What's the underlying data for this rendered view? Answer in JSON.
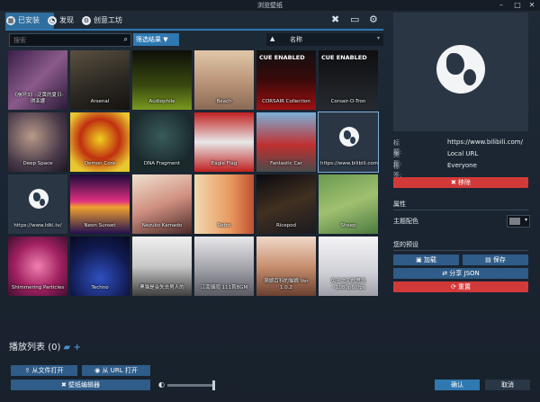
{
  "window": {
    "title": "浏览壁纸"
  },
  "tabs": [
    {
      "label": "已安装",
      "active": true
    },
    {
      "label": "发现",
      "active": false
    },
    {
      "label": "创意工坊",
      "active": false
    }
  ],
  "search": {
    "placeholder": "搜索"
  },
  "filter": {
    "label": "筛选结果"
  },
  "sort": {
    "label": "名称"
  },
  "wallpapers": [
    {
      "title": "《崩坏3》-泛黄的夏日-琪亚娜"
    },
    {
      "title": "Arsenal"
    },
    {
      "title": "Audiophile"
    },
    {
      "title": "Beach"
    },
    {
      "title": "CORSAIR Collection",
      "badge": "CUE ENABLED"
    },
    {
      "title": "Corsair-O-Tron",
      "badge": "CUE ENABLED"
    },
    {
      "title": "Deep Space"
    },
    {
      "title": "Demon Core"
    },
    {
      "title": "DNA Fragment"
    },
    {
      "title": "Eagle Flag"
    },
    {
      "title": "Fantastic Car"
    },
    {
      "title": "https://www.bilibili.com/"
    },
    {
      "title": "https://www.ldkl.tv/"
    },
    {
      "title": "Neon Sunset"
    },
    {
      "title": "Nezuko Kamado"
    },
    {
      "title": "Retro"
    },
    {
      "title": "Ricepod"
    },
    {
      "title": "Sheep"
    },
    {
      "title": "Shimmering Particles"
    },
    {
      "title": "Techno"
    },
    {
      "title": "黑猫是会失去男人的"
    },
    {
      "title": "江南烟雨 111首BGM"
    },
    {
      "title": "萌娘百科的猫娘 Ver 1.0.2"
    },
    {
      "title": "兔子之间的思念~1080p60fps"
    }
  ],
  "detail": {
    "rows": [
      {
        "key": "标题:",
        "value": "https://www.bilibili.com/"
      },
      {
        "key": "类型:",
        "value": "Local URL"
      },
      {
        "key": "标签:",
        "value": "Everyone"
      }
    ],
    "remove_label": "✖ 移除",
    "properties_title": "属性",
    "theme_color_label": "主题配色",
    "presets_title": "您的预设",
    "load_label": "加载",
    "save_label": "保存",
    "share_label": "分享 JSON",
    "reset_label": "重置"
  },
  "playlist": {
    "label": "播放列表",
    "count": "(0)"
  },
  "bottom": {
    "open_file": "从文件打开",
    "open_url": "从 URL 打开",
    "editor": "壁纸编辑器",
    "ok": "确认",
    "cancel": "取消"
  },
  "colors": {
    "accent": "#2f78b0",
    "danger": "#d23a3a",
    "button": "#2f5c88"
  }
}
